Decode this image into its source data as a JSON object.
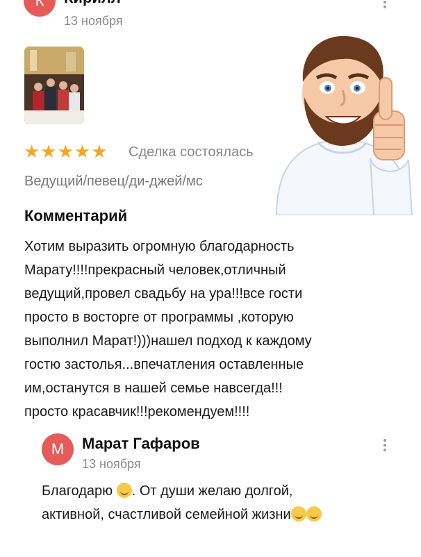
{
  "review": {
    "author": {
      "name": "Кирилл",
      "initial": "К",
      "date": "13 ноября"
    },
    "rating": {
      "stars": 5,
      "stars_text": "★★★★★",
      "label": "Сделка состоялась"
    },
    "category": "Ведущий/певец/ди-джей/мс",
    "comment_heading": "Комментарий",
    "comment_lines": [
      "Хотим выразить огромную благодарность",
      "Марату!!!!прекрасный человек,отличный",
      "ведущий,провел свадьбу на ура!!!все гости",
      "просто в восторге от программы ,которую",
      "выполнил Марат!)))нашел подход к каждому",
      "гостю застолья...впечатления оставленные",
      "им,останутся в нашей семье навсегда!!!",
      "просто красавчик!!!рекомендуем!!!!"
    ]
  },
  "reply": {
    "author": {
      "name": "Марат Гафаров",
      "initial": "М",
      "date": "13 ноября"
    },
    "line1_a": "Благодарю",
    "line1_b": ". От души желаю долгой,",
    "line2": "активной, счастливой семейной жизни"
  },
  "colors": {
    "avatar_red": "#e65a57",
    "star_gold": "#f5a623"
  },
  "icons": [
    "more-vert-icon",
    "star-icon",
    "smile-emoji-icon",
    "thumbs-up-icon"
  ]
}
